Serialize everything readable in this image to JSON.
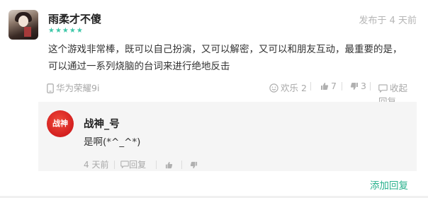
{
  "comment": {
    "username": "雨柔才不傻",
    "rating_stars": 5,
    "star_glyph": "★★★★★",
    "time": "发布于 4 天前",
    "text": "这个游戏非常棒，既可以自己扮演，又可以解密，又可以和朋友互动，最重要的是，可以通过一系列烧脑的台词来进行绝地反击",
    "device": "华为荣耀9i",
    "reaction_label": "欢乐 2",
    "like_count": "7",
    "dislike_count": "3",
    "collapse_reply_label": "收起回复"
  },
  "reply": {
    "avatar_text": "战神",
    "username": "战神_号",
    "text": "是啊(*^_^*)",
    "time": "4 天前",
    "reply_label": "回复"
  },
  "footer": {
    "add_reply_label": "添加回复"
  },
  "colors": {
    "accent": "#2bb28e",
    "star": "#3ec7a8",
    "muted": "#a8a8a8"
  }
}
